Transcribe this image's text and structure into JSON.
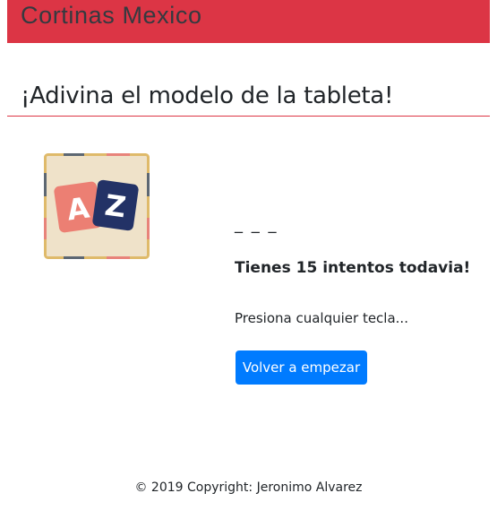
{
  "navbar": {
    "brand": "Cortinas Mexico",
    "color": "#dc3545"
  },
  "header": {
    "title": "¡Adivina el modelo de la tableta!"
  },
  "logo": {
    "icon": "az-letters-icon",
    "letters": [
      "A",
      "Z"
    ]
  },
  "game": {
    "blanks": "_ _ _",
    "attempts_text": "Tienes 15 intentos todavia!",
    "prompt": "Presiona cualquier tecla...",
    "restart_label": "Volver a empezar",
    "button_color": "#007bff"
  },
  "footer": {
    "text": "© 2019 Copyright: Jeronimo Alvarez"
  }
}
